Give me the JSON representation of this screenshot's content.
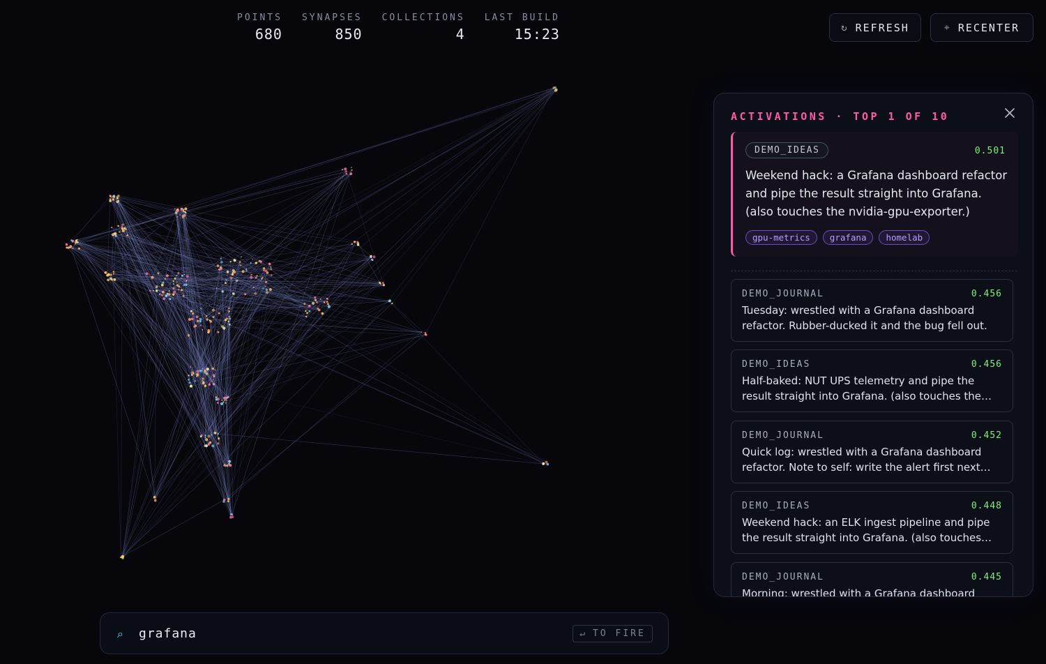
{
  "stats": [
    {
      "label": "POINTS",
      "value": "680"
    },
    {
      "label": "SYNAPSES",
      "value": "850"
    },
    {
      "label": "COLLECTIONS",
      "value": "4"
    },
    {
      "label": "LAST BUILD",
      "value": "15:23"
    }
  ],
  "toolbar": {
    "refresh_icon": "↻",
    "refresh_label": "REFRESH",
    "recenter_icon": "⌖",
    "recenter_label": "RECENTER"
  },
  "panel": {
    "title": "ACTIVATIONS · TOP 1 OF 10",
    "top": {
      "collection": "DEMO_IDEAS",
      "score": "0.501",
      "text": "Weekend hack: a Grafana dashboard refactor and pipe the result straight into Grafana. (also touches the nvidia-gpu-exporter.)",
      "tags": [
        "gpu-metrics",
        "grafana",
        "homelab"
      ]
    },
    "results": [
      {
        "collection": "DEMO_JOURNAL",
        "score": "0.456",
        "text": "Tuesday: wrestled with a Grafana dashboard refactor. Rubber-ducked it and the bug fell out."
      },
      {
        "collection": "DEMO_IDEAS",
        "score": "0.456",
        "text": "Half-baked: NUT UPS telemetry and pipe the result straight into Grafana. (also touches the nvidia-gp…"
      },
      {
        "collection": "DEMO_JOURNAL",
        "score": "0.452",
        "text": "Quick log: wrestled with a Grafana dashboard refactor. Note to self: write the alert first next time."
      },
      {
        "collection": "DEMO_IDEAS",
        "score": "0.448",
        "text": "Weekend hack: an ELK ingest pipeline and pipe the result straight into Grafana. (also touches Qdrant…"
      },
      {
        "collection": "DEMO_JOURNAL",
        "score": "0.445",
        "text": "Morning: wrestled with a Grafana dashboard refactor."
      }
    ]
  },
  "search": {
    "icon": "⌕",
    "value": "grafana",
    "hint_icon": "↵",
    "hint_label": "TO FIRE"
  },
  "colors": {
    "accent": "#ff5aa8",
    "score": "#7ff07a",
    "tag": "#b79cff",
    "edge": "#7d87c8"
  }
}
